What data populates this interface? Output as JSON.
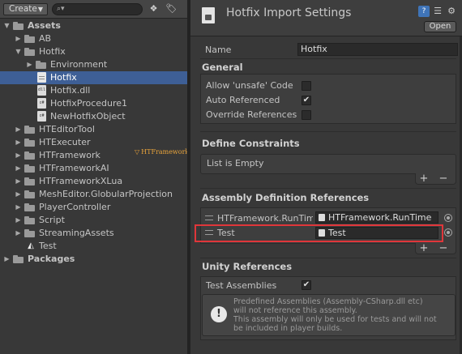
{
  "project": {
    "create_label": "Create",
    "tree": [
      {
        "label": "Assets",
        "expanded": true,
        "type": "folder",
        "bold": true
      },
      {
        "label": "AB",
        "type": "folder"
      },
      {
        "label": "Hotfix",
        "expanded": true,
        "type": "folder"
      },
      {
        "label": "Environment",
        "type": "folder"
      },
      {
        "label": "Hotfix",
        "type": "asmdef",
        "selected": true
      },
      {
        "label": "Hotfix.dll",
        "type": "dll"
      },
      {
        "label": "HotfixProcedure1",
        "type": "script"
      },
      {
        "label": "NewHotfixObject",
        "type": "script"
      },
      {
        "label": "HTEditorTool",
        "type": "folder"
      },
      {
        "label": "HTExecuter",
        "type": "folder"
      },
      {
        "label": "HTFramework",
        "type": "folder"
      },
      {
        "label": "HTFrameworkAI",
        "type": "folder"
      },
      {
        "label": "HTFrameworkXLua",
        "type": "folder"
      },
      {
        "label": "MeshEditor.GlobularProjection",
        "type": "folder"
      },
      {
        "label": "PlayerController",
        "type": "folder"
      },
      {
        "label": "Script",
        "type": "folder"
      },
      {
        "label": "StreamingAssets",
        "type": "folder"
      },
      {
        "label": "Test",
        "type": "unity"
      },
      {
        "label": "Packages",
        "type": "folder",
        "bold": true
      }
    ],
    "logo_text": "HTFramework"
  },
  "inspector": {
    "title": "Hotfix Import Settings",
    "open_label": "Open",
    "name_label": "Name",
    "name_value": "Hotfix",
    "general_header": "General",
    "allow_unsafe_label": "Allow 'unsafe' Code",
    "allow_unsafe_checked": false,
    "auto_referenced_label": "Auto Referenced",
    "auto_referenced_checked": true,
    "override_refs_label": "Override References",
    "override_refs_checked": false,
    "define_header": "Define Constraints",
    "define_empty": "List is Empty",
    "asm_header": "Assembly Definition References",
    "asm_refs": [
      {
        "name": "HTFramework.RunTime",
        "value": "HTFramework.RunTime"
      },
      {
        "name": "Test",
        "value": "Test"
      }
    ],
    "unity_header": "Unity References",
    "test_assemblies_label": "Test Assemblies",
    "test_assemblies_checked": true,
    "help_lines": [
      "Predefined Assemblies (Assembly-CSharp.dll etc)",
      "will not reference this assembly.",
      "This assembly will only be used for tests and will not",
      "be included in player builds."
    ],
    "plus": "+",
    "minus": "−"
  },
  "colors": {
    "selection": "#3e5f96",
    "highlight": "#e0363a",
    "logo": "#e8a33b"
  }
}
